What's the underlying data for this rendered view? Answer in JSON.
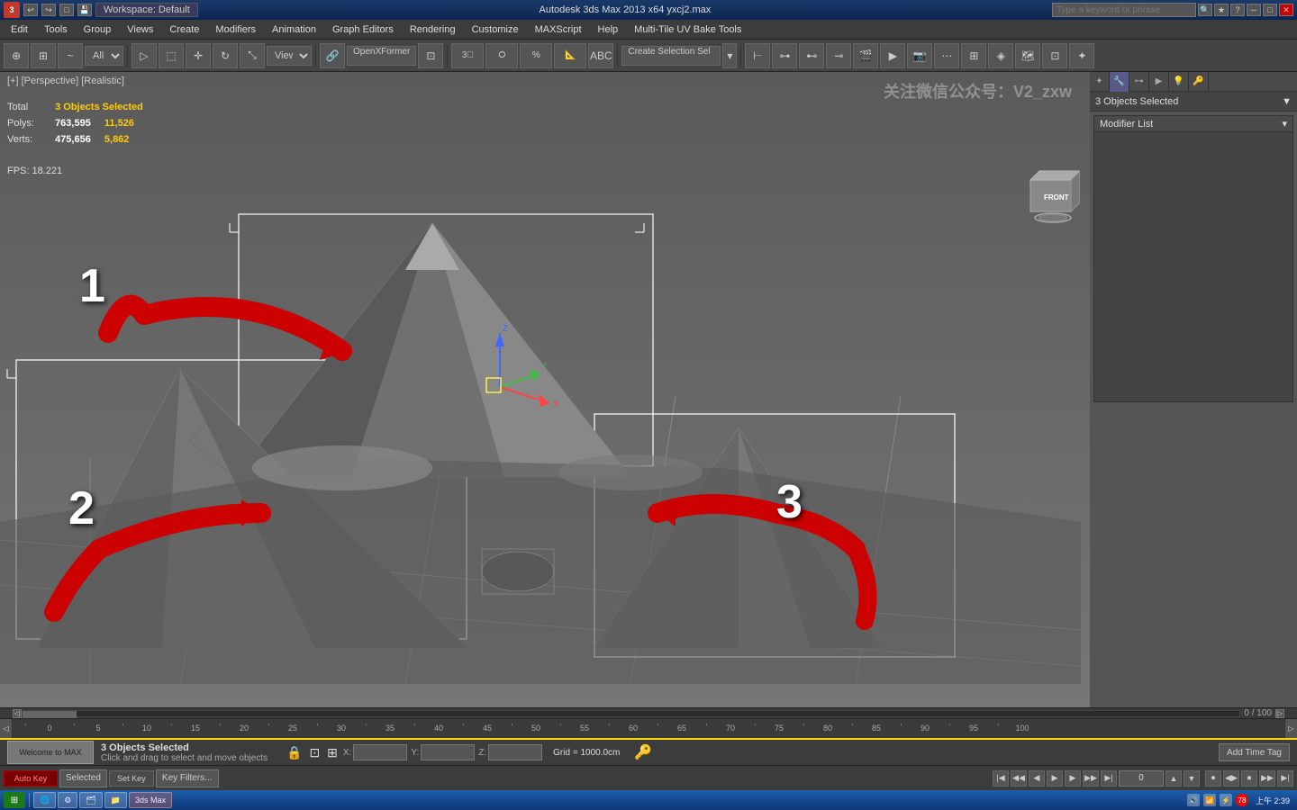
{
  "titlebar": {
    "icon": "autodesk-icon",
    "toolbar_icons_left": [
      "undo",
      "redo"
    ],
    "app_name": "Workspace: Default",
    "file_title": "Autodesk 3ds Max 2013 x64    yxcj2.max",
    "search_placeholder": "Type a keyword or phrase",
    "min_label": "─",
    "max_label": "□",
    "close_label": "✕"
  },
  "menubar": {
    "items": [
      "Edit",
      "Tools",
      "Group",
      "Views",
      "Create",
      "Modifiers",
      "Animation",
      "Graph Editors",
      "Rendering",
      "Customize",
      "MAXScript",
      "Help",
      "Multi-Tile UV Bake Tools"
    ]
  },
  "toolbar": {
    "dropdowns": [
      "All"
    ],
    "view_dropdown": "View",
    "openxformer": "OpenXFormer",
    "create_selection": "Create Selection Sel",
    "tools": [
      "select",
      "move",
      "rotate",
      "scale",
      "link",
      "unlink",
      "bind-space",
      "snap",
      "angle-snap",
      "percent-snap",
      "spinner-snap",
      "mirror",
      "array",
      "align",
      "layer",
      "curve-editor"
    ]
  },
  "viewport": {
    "label": "[+] [Perspective] [Realistic]",
    "watermark": "关注微信公众号：V2_zxw",
    "stats": {
      "header_total": "Total",
      "header_selected": "3 Objects Selected",
      "polys_label": "Polys:",
      "polys_total": "763,595",
      "polys_selected": "11,526",
      "verts_label": "Verts:",
      "verts_total": "475,656",
      "verts_selected": "5,862"
    },
    "fps": "FPS:",
    "fps_value": "18.221",
    "objects": [
      {
        "id": "1",
        "label": "1"
      },
      {
        "id": "2",
        "label": "2"
      },
      {
        "id": "3",
        "label": "3"
      }
    ]
  },
  "right_panel": {
    "selection_info": "3 Objects Selected",
    "modifier_list_label": "Modifier List",
    "tabs": [
      "hierarchy",
      "motion",
      "display",
      "utilities"
    ]
  },
  "timeline": {
    "position": "0",
    "end": "100",
    "position_display": "0 / 100",
    "ruler_marks": [
      "0",
      "5",
      "10",
      "15",
      "20",
      "25",
      "30",
      "35",
      "40",
      "45",
      "50",
      "55",
      "60",
      "65",
      "70",
      "75",
      "80",
      "85",
      "90",
      "95",
      "100"
    ]
  },
  "statusbar": {
    "selection_text": "3 Objects Selected",
    "help_text": "Click and drag to select and move objects",
    "x_label": "X:",
    "y_label": "Y:",
    "z_label": "Z:",
    "x_value": "",
    "y_value": "",
    "z_value": "",
    "grid_info": "Grid = 1000.0cm",
    "add_time_tag": "Add Time Tag"
  },
  "playback": {
    "autokey_label": "Auto Key",
    "autokey_status": "Selected",
    "setkey_label": "Set Key",
    "keyfilters_label": "Key Filters...",
    "time_display": "0",
    "buttons": [
      "go-start",
      "prev-frame",
      "play-back",
      "play",
      "play-forward",
      "next-frame",
      "go-end"
    ]
  },
  "taskbar": {
    "start": "⊞",
    "items": [
      "explorer",
      "browser",
      "chrome",
      "folder",
      "3dsmax"
    ],
    "time": "上午 2:39",
    "notification_count": "78"
  },
  "welcome": {
    "label": "Welcome to MAX"
  }
}
